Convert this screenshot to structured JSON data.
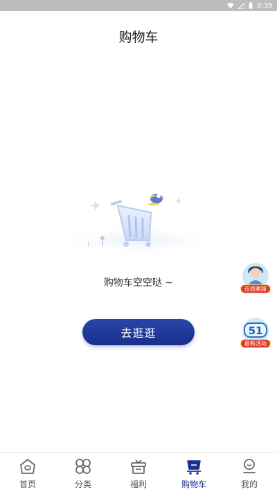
{
  "status_bar": {
    "time": "9:35"
  },
  "header": {
    "title": "购物车"
  },
  "empty_state": {
    "message": "购物车空空哒 ~",
    "button_label": "去逛逛"
  },
  "floating": {
    "service_label": "在线客服",
    "activity_label": "最新活动",
    "activity_number": "51"
  },
  "colors": {
    "accent": "#1a2f8f",
    "badge_red": "#e03a2a",
    "statusbar": "#bdbdbd"
  },
  "bottom_nav": {
    "active": "购物车",
    "items": [
      {
        "label": "首页",
        "icon": "home-icon"
      },
      {
        "label": "分类",
        "icon": "category-icon"
      },
      {
        "label": "福利",
        "icon": "gift-icon"
      },
      {
        "label": "购物车",
        "icon": "cart-icon"
      },
      {
        "label": "我的",
        "icon": "profile-icon"
      }
    ]
  }
}
